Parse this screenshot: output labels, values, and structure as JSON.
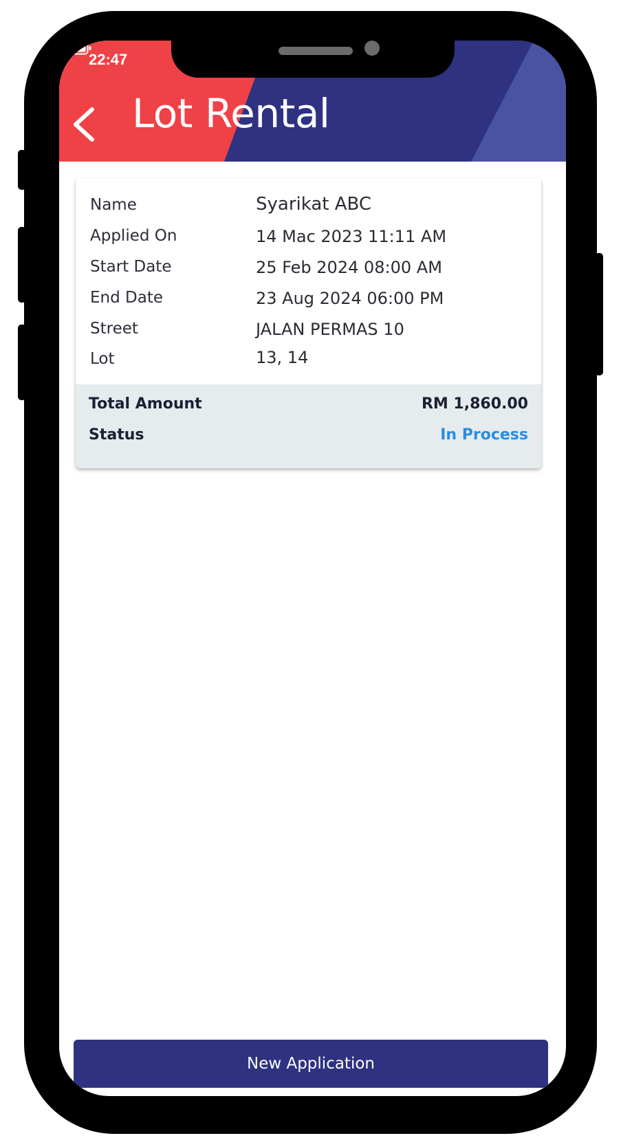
{
  "status_bar": {
    "time": "22:47",
    "wifi_icon": "wifi-icon",
    "battery_icon": "battery-full-icon"
  },
  "header": {
    "back_icon": "chevron-left-icon",
    "title": "Lot Rental",
    "colors": {
      "red": "#ef4246",
      "navy": "#2e3281",
      "light_navy": "#4a52a3"
    }
  },
  "application": {
    "rows": [
      {
        "label": "Name",
        "value": "Syarikat ABC"
      },
      {
        "label": "Applied On",
        "value": "14 Mac 2023 11:11 AM"
      },
      {
        "label": "Start Date",
        "value": "25 Feb 2024 08:00 AM"
      },
      {
        "label": "End Date",
        "value": "23 Aug 2024 06:00 PM"
      },
      {
        "label": "Street",
        "value": "JALAN PERMAS 10"
      },
      {
        "label": "Lot",
        "value": "13, 14"
      }
    ],
    "total_amount_label": "Total Amount",
    "total_amount_value": "RM 1,860.00",
    "status_label": "Status",
    "status_value": "In Process",
    "status_color": "#2b8ce0"
  },
  "footer": {
    "new_application_label": "New Application",
    "button_color": "#2e3281"
  }
}
